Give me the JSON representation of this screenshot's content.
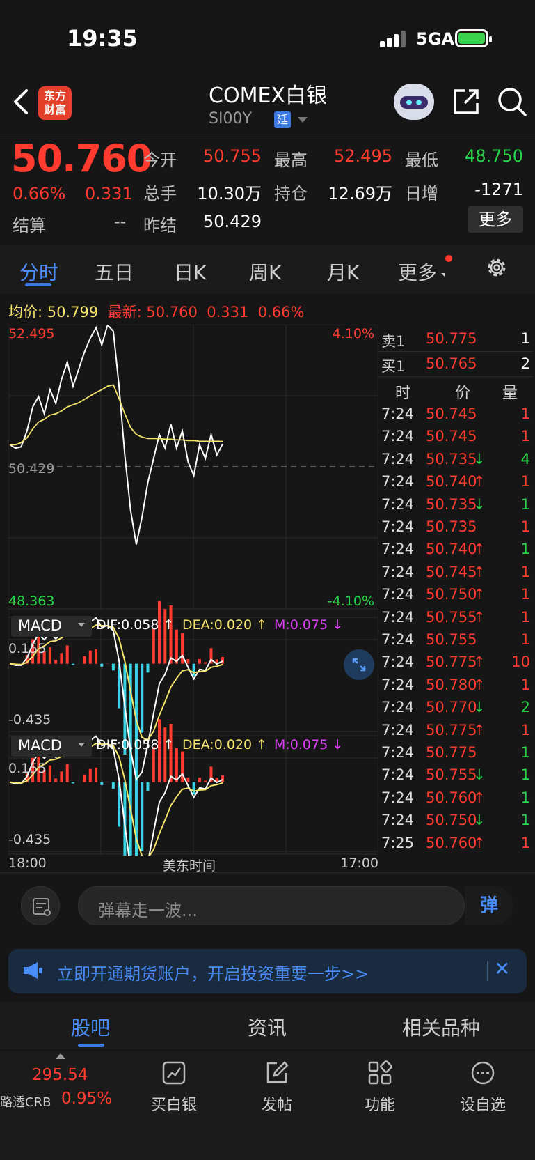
{
  "status_bar": {
    "time": "19:35",
    "network": "5GA"
  },
  "header": {
    "title": "COMEX白银",
    "symbol": "SI00Y",
    "delay_badge": "延",
    "logo_text_1": "东方",
    "logo_text_2": "财富"
  },
  "quote": {
    "price": "50.760",
    "change_pct": "0.66%",
    "change": "0.331",
    "settle_label": "结算",
    "settle_value": "--",
    "fields": [
      {
        "label": "今开",
        "value": "50.755",
        "color": "red"
      },
      {
        "label": "最高",
        "value": "52.495",
        "color": "red"
      },
      {
        "label": "最低",
        "value": "48.750",
        "color": "green"
      },
      {
        "label": "总手",
        "value": "10.30万",
        "color": "white"
      },
      {
        "label": "持仓",
        "value": "12.69万",
        "color": "white"
      },
      {
        "label": "日增",
        "value": "-1271",
        "color": "white"
      },
      {
        "label": "昨结",
        "value": "50.429",
        "color": "white"
      }
    ],
    "more_label": "更多"
  },
  "tabs": [
    "分时",
    "五日",
    "日K",
    "周K",
    "月K",
    "更多"
  ],
  "active_tab": "分时",
  "info_line": {
    "avg_label": "均价:",
    "avg": "50.799",
    "last_label": "最新:",
    "last": "50.760",
    "chg": "0.331",
    "pct": "0.66%"
  },
  "chart_data": {
    "type": "line",
    "title": "",
    "y_top": "52.495",
    "y_mid": "50.429",
    "y_bottom": "48.363",
    "pct_top": "4.10%",
    "pct_bottom": "-4.10%",
    "x_start": "18:00",
    "x_mid": "美东时间",
    "x_end": "17:00",
    "ylim": [
      48.363,
      52.495
    ],
    "series": [
      {
        "values": [
          50.75,
          50.7,
          50.72,
          50.95,
          51.3,
          51.45,
          51.2,
          51.55,
          51.35,
          51.7,
          51.95,
          51.6,
          51.85,
          52.1,
          52.3,
          52.45,
          52.2,
          52.49,
          52.4,
          51.6,
          50.6,
          49.8,
          49.3,
          49.7,
          50.2,
          50.55,
          50.9,
          50.7,
          51.05,
          50.7,
          50.95,
          50.5,
          50.3,
          50.75,
          50.55,
          50.9,
          50.6,
          50.76
        ]
      },
      {
        "values": [
          50.75,
          50.75,
          50.78,
          50.85,
          50.98,
          51.08,
          51.12,
          51.18,
          51.2,
          51.24,
          51.3,
          51.33,
          51.36,
          51.41,
          51.46,
          51.51,
          51.55,
          51.6,
          51.62,
          51.42,
          51.2,
          51.0,
          50.9,
          50.86,
          50.84,
          50.84,
          50.84,
          50.83,
          50.83,
          50.82,
          50.82,
          50.81,
          50.81,
          50.8,
          50.8,
          50.8,
          50.8,
          50.799
        ]
      }
    ],
    "macd": {
      "label": "MACD",
      "dif": "DIF:0.058 ↑",
      "dea": "DEA:0.020 ↑",
      "m": "M:0.075 ↓",
      "top": "0.155",
      "bottom": "-0.435"
    }
  },
  "order_book": {
    "asks": [
      {
        "label": "卖1",
        "price": "50.775",
        "qty": "1"
      }
    ],
    "bids": [
      {
        "label": "买1",
        "price": "50.765",
        "qty": "2"
      }
    ],
    "trade_header": {
      "time": "时",
      "price": "价",
      "qty": "量"
    },
    "trades": [
      {
        "time": "7:24",
        "price": "50.745",
        "dir": "",
        "qty": "1",
        "qcolor": "red"
      },
      {
        "time": "7:24",
        "price": "50.745",
        "dir": "",
        "qty": "1",
        "qcolor": "red"
      },
      {
        "time": "7:24",
        "price": "50.735",
        "dir": "↓",
        "qty": "4",
        "qcolor": "green"
      },
      {
        "time": "7:24",
        "price": "50.740",
        "dir": "↑",
        "qty": "1",
        "qcolor": "red"
      },
      {
        "time": "7:24",
        "price": "50.735",
        "dir": "↓",
        "qty": "1",
        "qcolor": "green"
      },
      {
        "time": "7:24",
        "price": "50.735",
        "dir": "",
        "qty": "1",
        "qcolor": "red"
      },
      {
        "time": "7:24",
        "price": "50.740",
        "dir": "↑",
        "qty": "1",
        "qcolor": "green"
      },
      {
        "time": "7:24",
        "price": "50.745",
        "dir": "↑",
        "qty": "1",
        "qcolor": "red"
      },
      {
        "time": "7:24",
        "price": "50.750",
        "dir": "↑",
        "qty": "1",
        "qcolor": "red"
      },
      {
        "time": "7:24",
        "price": "50.755",
        "dir": "↑",
        "qty": "1",
        "qcolor": "red"
      },
      {
        "time": "7:24",
        "price": "50.755",
        "dir": "",
        "qty": "1",
        "qcolor": "red"
      },
      {
        "time": "7:24",
        "price": "50.775",
        "dir": "↑",
        "qty": "10",
        "qcolor": "red"
      },
      {
        "time": "7:24",
        "price": "50.780",
        "dir": "↑",
        "qty": "1",
        "qcolor": "red"
      },
      {
        "time": "7:24",
        "price": "50.770",
        "dir": "↓",
        "qty": "2",
        "qcolor": "green"
      },
      {
        "time": "7:24",
        "price": "50.775",
        "dir": "↑",
        "qty": "1",
        "qcolor": "red"
      },
      {
        "time": "7:24",
        "price": "50.775",
        "dir": "",
        "qty": "1",
        "qcolor": "green"
      },
      {
        "time": "7:24",
        "price": "50.755",
        "dir": "↓",
        "qty": "1",
        "qcolor": "green"
      },
      {
        "time": "7:24",
        "price": "50.760",
        "dir": "↑",
        "qty": "1",
        "qcolor": "green"
      },
      {
        "time": "7:24",
        "price": "50.750",
        "dir": "↓",
        "qty": "1",
        "qcolor": "green"
      },
      {
        "time": "7:25",
        "price": "50.760",
        "dir": "↑",
        "qty": "1",
        "qcolor": "red"
      }
    ]
  },
  "danmaku": {
    "placeholder": "弹幕走一波...",
    "send": "弹"
  },
  "banner": {
    "text": "立即开通期货账户，开启投资重要一步>>",
    "close": "✕"
  },
  "bottom_tabs": [
    "股吧",
    "资讯",
    "相关品种"
  ],
  "toolbar": {
    "index_value": "295.54",
    "index_name": "路透CRB",
    "index_pct": "0.95%",
    "items": [
      "买白银",
      "发帖",
      "功能",
      "设自选"
    ]
  },
  "colors": {
    "up": "#ff3b30",
    "down": "#27d34a",
    "accent": "#3b78e0",
    "avg": "#f5e46a"
  }
}
